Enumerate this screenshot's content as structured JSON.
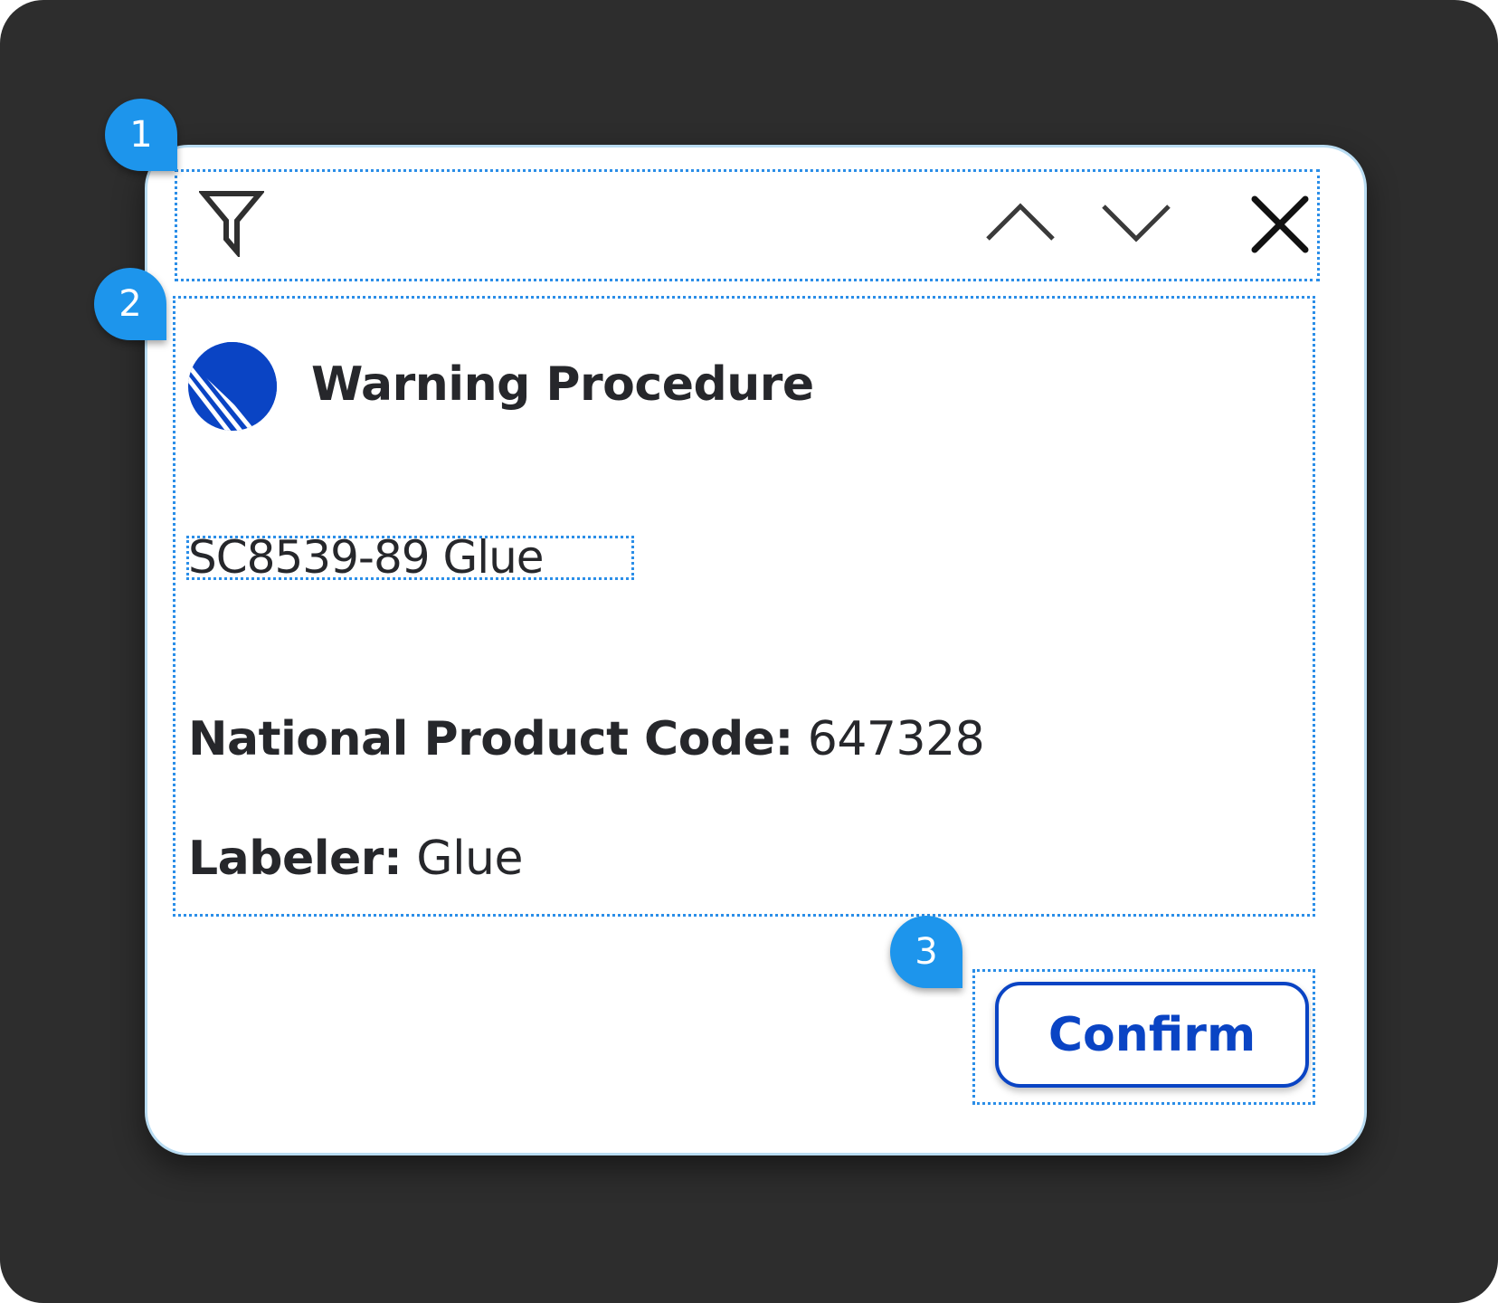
{
  "annotations": {
    "markers": [
      "1",
      "2",
      "3"
    ],
    "marker_color": "#1d95ec",
    "outline_color": "#2b8ee8"
  },
  "toolbar": {
    "icons": [
      "filter-icon",
      "chevron-up-icon",
      "chevron-down-icon",
      "close-icon"
    ]
  },
  "content": {
    "logo_icon": "striped-circle-logo",
    "title": "Warning Procedure",
    "product_name": "SC8539-89 Glue",
    "fields": [
      {
        "label": "National Product Code:",
        "value": "647328"
      },
      {
        "label": "Labeler:",
        "value": "Glue"
      }
    ]
  },
  "actions": {
    "confirm_label": "Confirm"
  },
  "colors": {
    "background": "#2d2d2d",
    "card": "#ffffff",
    "card_border": "#b9dcf2",
    "brand_blue": "#0a44c4",
    "text": "#26272b"
  }
}
